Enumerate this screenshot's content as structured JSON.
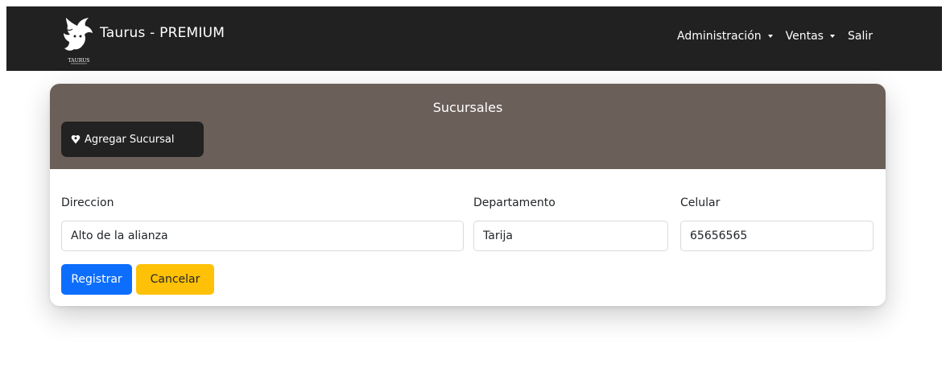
{
  "navbar": {
    "brand_text": "Taurus - PREMIUM",
    "logo_small_text": "TAURUS",
    "links": [
      {
        "label": "Administración",
        "dropdown": true
      },
      {
        "label": "Ventas",
        "dropdown": true
      },
      {
        "label": "Salir",
        "dropdown": false
      }
    ]
  },
  "card": {
    "title": "Sucursales",
    "add_button_label": "Agregar Sucursal",
    "add_button_icon": "map-pin-heart-icon",
    "form": {
      "direccion": {
        "label": "Direccion",
        "value": "Alto de la alianza"
      },
      "departamento": {
        "label": "Departamento",
        "value": "Tarija"
      },
      "celular": {
        "label": "Celular",
        "value": "65656565"
      }
    },
    "submit_label": "Registrar",
    "cancel_label": "Cancelar"
  },
  "colors": {
    "navbar_bg": "#212121",
    "card_header_bg": "#6b6059",
    "primary": "#0d6efd",
    "warning": "#ffc107"
  }
}
